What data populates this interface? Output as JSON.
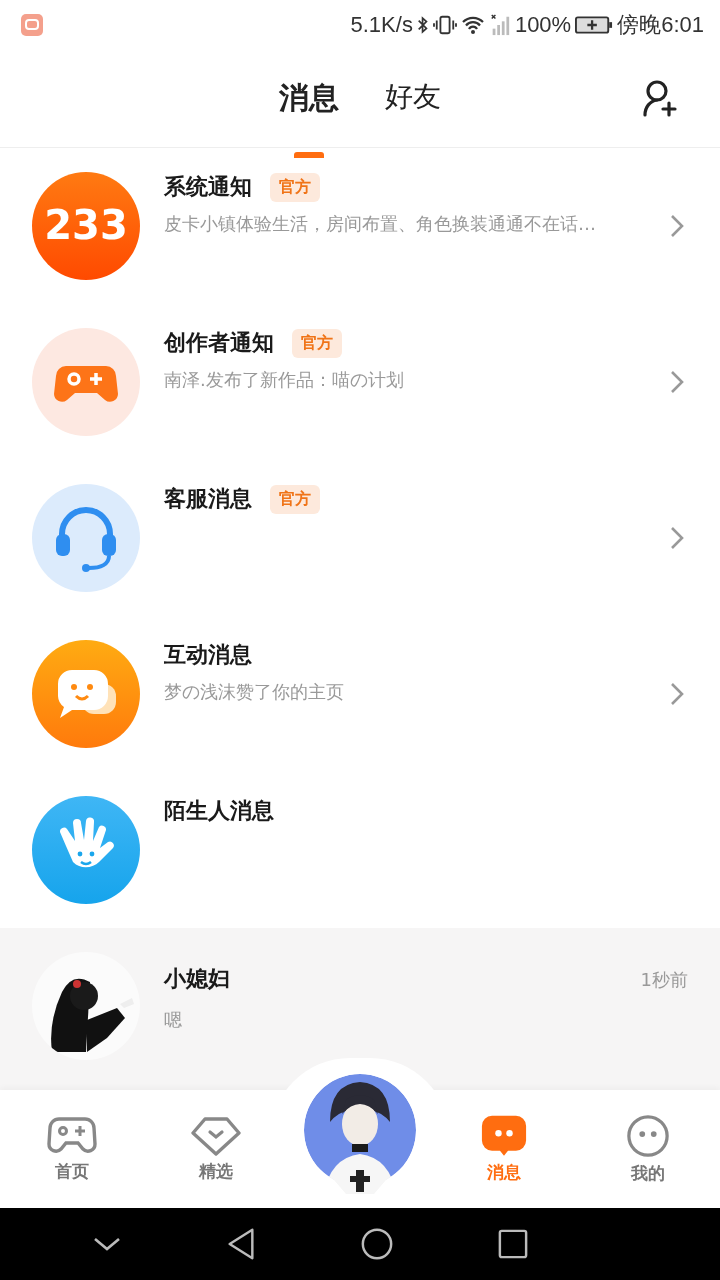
{
  "status_bar": {
    "speed": "5.1K/s",
    "battery": "100%",
    "time": "傍晚6:01"
  },
  "header": {
    "tabs": [
      {
        "label": "消息",
        "selected": true
      },
      {
        "label": "好友",
        "selected": false
      }
    ]
  },
  "notifications": [
    {
      "kind": "system",
      "icon_text": "233",
      "title": "系统通知",
      "badge": "官方",
      "preview": "皮卡小镇体验生活，房间布置、角色换装通通不在话…",
      "has_arrow": true
    },
    {
      "kind": "creator",
      "title": "创作者通知",
      "badge": "官方",
      "preview": "南泽.发布了新作品：喵の计划",
      "has_arrow": true
    },
    {
      "kind": "service",
      "title": "客服消息",
      "badge": "官方",
      "has_arrow": true
    },
    {
      "kind": "interaction",
      "title": "互动消息",
      "preview": "梦の浅沫赞了你的主页",
      "has_arrow": true
    },
    {
      "kind": "stranger",
      "title": "陌生人消息",
      "has_arrow": false
    }
  ],
  "conversations": [
    {
      "name": "小媳妇",
      "preview": "嗯",
      "time": "1秒前"
    }
  ],
  "bottom_nav": [
    {
      "kind": "home",
      "label": "首页",
      "selected": false
    },
    {
      "kind": "featured",
      "label": "精选",
      "selected": false
    },
    {
      "kind": "avatar"
    },
    {
      "kind": "messages",
      "label": "消息",
      "selected": true
    },
    {
      "kind": "profile",
      "label": "我的",
      "selected": false
    }
  ]
}
